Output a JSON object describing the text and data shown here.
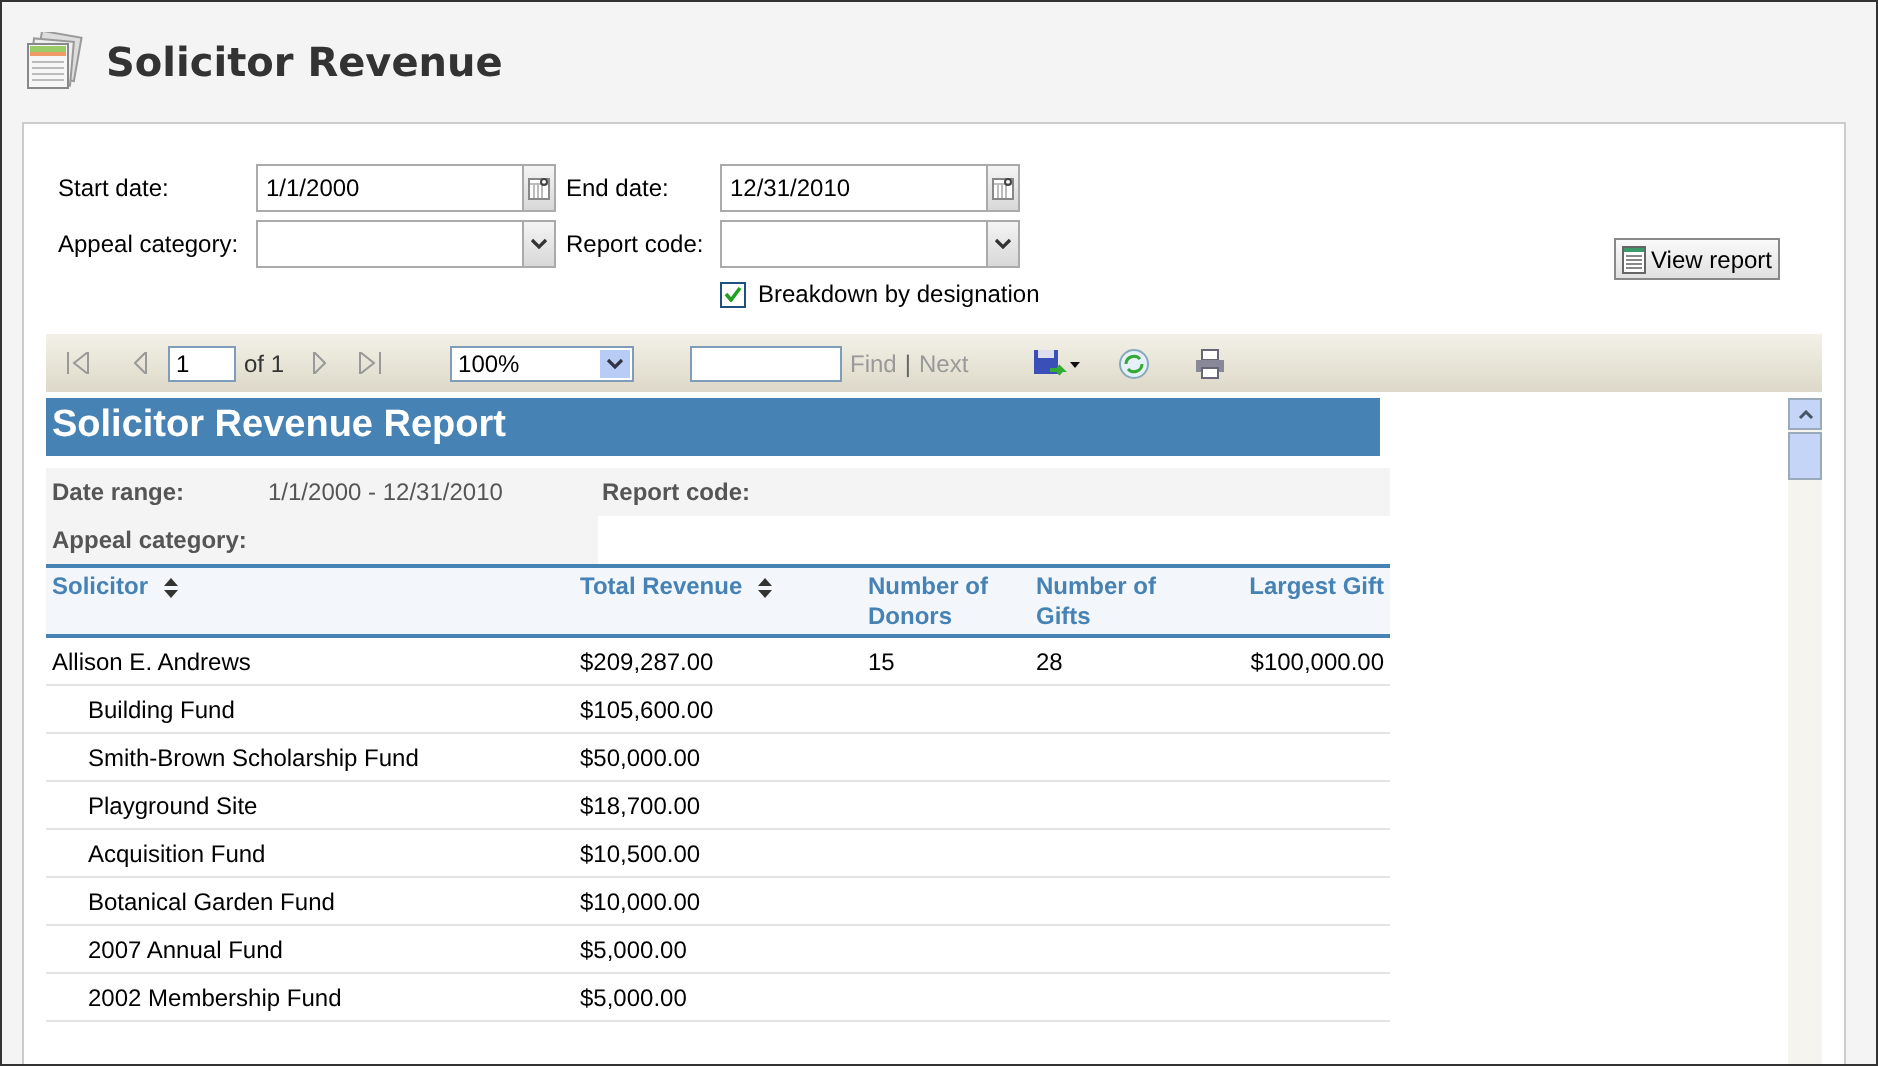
{
  "page": {
    "title": "Solicitor Revenue"
  },
  "form": {
    "start_date": {
      "label": "Start date:",
      "value": "1/1/2000"
    },
    "end_date": {
      "label": "End date:",
      "value": "12/31/2010"
    },
    "appeal_category": {
      "label": "Appeal category:"
    },
    "report_code": {
      "label": "Report code:"
    },
    "breakdown": {
      "label": "Breakdown by designation",
      "checked": true
    },
    "view_report": "View report"
  },
  "toolbar": {
    "page": "1",
    "page_count": "of 1",
    "zoom": "100%",
    "find": "Find",
    "separator": "|",
    "next": "Next"
  },
  "report": {
    "title": "Solicitor Revenue Report",
    "date_range_label": "Date range:",
    "date_range": "1/1/2000 - 12/31/2010",
    "report_code_label": "Report code:",
    "appeal_category_label": "Appeal category:",
    "columns": [
      {
        "label": "Solicitor",
        "sortable": true
      },
      {
        "label": "Total Revenue",
        "sortable": true
      },
      {
        "label": "Number of Donors",
        "sortable": false
      },
      {
        "label": "Number of Gifts",
        "sortable": false
      },
      {
        "label": "Largest Gift",
        "sortable": false
      }
    ],
    "rows": [
      {
        "kind": "solicitor",
        "cells": [
          "Allison E. Andrews",
          "$209,287.00",
          "15",
          "28",
          "$100,000.00"
        ]
      },
      {
        "kind": "designation",
        "cells": [
          "Building Fund",
          "$105,600.00"
        ]
      },
      {
        "kind": "designation",
        "cells": [
          "Smith-Brown Scholarship Fund",
          "$50,000.00"
        ]
      },
      {
        "kind": "designation",
        "cells": [
          "Playground Site",
          "$18,700.00"
        ]
      },
      {
        "kind": "designation",
        "cells": [
          "Acquisition Fund",
          "$10,500.00"
        ]
      },
      {
        "kind": "designation",
        "cells": [
          "Botanical Garden Fund",
          "$10,000.00"
        ]
      },
      {
        "kind": "designation",
        "cells": [
          "2007 Annual Fund",
          "$5,000.00"
        ]
      },
      {
        "kind": "designation",
        "cells": [
          "2002 Membership Fund",
          "$5,000.00"
        ]
      }
    ]
  }
}
